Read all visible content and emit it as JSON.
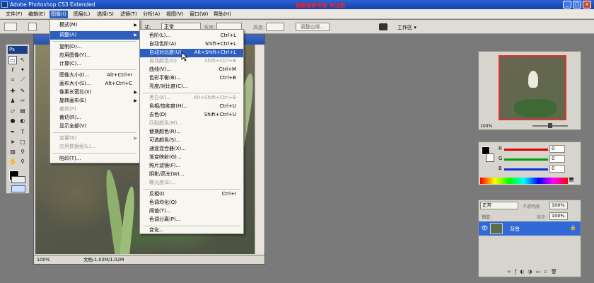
{
  "titlebar": {
    "title": "Adobe Photoshop CS3 Extended",
    "registration": "超级录屏专家  未注册",
    "buttons": [
      "_",
      "□",
      "×"
    ]
  },
  "menubar": {
    "items": [
      "文件(F)",
      "编辑(E)",
      "图像(I)",
      "图层(L)",
      "选择(S)",
      "滤镜(T)",
      "分析(A)",
      "视图(V)",
      "窗口(W)",
      "帮助(H)"
    ],
    "active_index": 2
  },
  "options": {
    "mode_label": "式:",
    "mode_value": "正常",
    "width_label": "宽度:",
    "height_label": "高度:",
    "refine_button": "调整边缘...",
    "workspace_label": "工作区 ▾"
  },
  "toolbox": {
    "badge": "Ps"
  },
  "image_menu": {
    "items": [
      {
        "label": "模式(M)",
        "shortcut": "",
        "submenu": true,
        "disabled": false
      },
      {
        "label": "调整(A)",
        "shortcut": "",
        "submenu": true,
        "disabled": false,
        "highlighted": true
      },
      {
        "label": "复制(D)...",
        "shortcut": "",
        "submenu": false,
        "disabled": false
      },
      {
        "label": "应用图像(Y)...",
        "shortcut": "",
        "submenu": false,
        "disabled": false
      },
      {
        "label": "计算(C)...",
        "shortcut": "",
        "submenu": false,
        "disabled": false
      },
      {
        "label": "图像大小(I)...",
        "shortcut": "Alt+Ctrl+I",
        "submenu": false,
        "disabled": false
      },
      {
        "label": "画布大小(S)...",
        "shortcut": "Alt+Ctrl+C",
        "submenu": false,
        "disabled": false
      },
      {
        "label": "像素长宽比(X)",
        "shortcut": "",
        "submenu": true,
        "disabled": false
      },
      {
        "label": "旋转画布(E)",
        "shortcut": "",
        "submenu": true,
        "disabled": false
      },
      {
        "label": "裁剪(P)",
        "shortcut": "",
        "submenu": false,
        "disabled": true
      },
      {
        "label": "裁切(R)...",
        "shortcut": "",
        "submenu": false,
        "disabled": false
      },
      {
        "label": "显示全部(V)",
        "shortcut": "",
        "submenu": false,
        "disabled": false
      },
      {
        "label": "变量(B)",
        "shortcut": "",
        "submenu": true,
        "disabled": true
      },
      {
        "label": "应用数据组(L)...",
        "shortcut": "",
        "submenu": false,
        "disabled": true
      },
      {
        "label": "陷印(T)...",
        "shortcut": "",
        "submenu": false,
        "disabled": false
      }
    ]
  },
  "adjust_menu": {
    "items": [
      {
        "label": "色阶(L)...",
        "shortcut": "Ctrl+L",
        "disabled": false
      },
      {
        "label": "自动色阶(A)",
        "shortcut": "Shift+Ctrl+L",
        "disabled": false
      },
      {
        "label": "自动对比度(U)",
        "shortcut": "Alt+Shift+Ctrl+L",
        "disabled": false,
        "highlighted": true
      },
      {
        "label": "自动颜色(O)",
        "shortcut": "Shift+Ctrl+B",
        "disabled": true
      },
      {
        "label": "曲线(V)...",
        "shortcut": "Ctrl+M",
        "disabled": false
      },
      {
        "label": "色彩平衡(B)...",
        "shortcut": "Ctrl+B",
        "disabled": false
      },
      {
        "label": "亮度/对比度(C)...",
        "shortcut": "",
        "disabled": false
      },
      {
        "label": "黑白(K)...",
        "shortcut": "Alt+Shift+Ctrl+B",
        "disabled": true
      },
      {
        "label": "色相/饱和度(H)...",
        "shortcut": "Ctrl+U",
        "disabled": false
      },
      {
        "label": "去色(D)",
        "shortcut": "Shift+Ctrl+U",
        "disabled": false
      },
      {
        "label": "匹配颜色(M)...",
        "shortcut": "",
        "disabled": true
      },
      {
        "label": "替换颜色(R)...",
        "shortcut": "",
        "disabled": false
      },
      {
        "label": "可选颜色(S)...",
        "shortcut": "",
        "disabled": false
      },
      {
        "label": "通道混合器(X)...",
        "shortcut": "",
        "disabled": false
      },
      {
        "label": "渐变映射(G)...",
        "shortcut": "",
        "disabled": false
      },
      {
        "label": "照片滤镜(F)...",
        "shortcut": "",
        "disabled": false
      },
      {
        "label": "阴影/高光(W)...",
        "shortcut": "",
        "disabled": false
      },
      {
        "label": "曝光度(E)...",
        "shortcut": "",
        "disabled": true
      },
      {
        "label": "反相(I)",
        "shortcut": "Ctrl+I",
        "disabled": false
      },
      {
        "label": "色调均化(Q)",
        "shortcut": "",
        "disabled": false
      },
      {
        "label": "阈值(T)...",
        "shortcut": "",
        "disabled": false
      },
      {
        "label": "色调分离(P)...",
        "shortcut": "",
        "disabled": false
      },
      {
        "label": "变化...",
        "shortcut": "",
        "disabled": false
      }
    ]
  },
  "document": {
    "zoom": "100%",
    "status": "文档:1.02M/1.02M"
  },
  "navigator": {
    "zoom": "100%"
  },
  "color_panel": {
    "channels": [
      {
        "name": "R",
        "value": "0",
        "color": "#e00000"
      },
      {
        "name": "G",
        "value": "0",
        "color": "#00a000"
      },
      {
        "name": "B",
        "value": "0",
        "color": "#1030e0"
      }
    ]
  },
  "layers_panel": {
    "blend_mode": "正常",
    "opacity_label": "不透明度:",
    "opacity_value": "100%",
    "lock_label": "锁定:",
    "fill_label": "填充:",
    "fill_value": "100%",
    "layer_name": "背景"
  }
}
